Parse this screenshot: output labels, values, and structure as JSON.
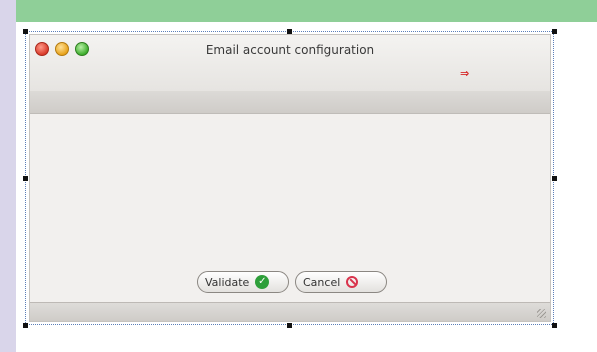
{
  "window": {
    "title": "Email account configuration"
  },
  "title_controls": {
    "close_glyph": "",
    "minimize_glyph": "",
    "maximize_glyph": ""
  },
  "icons": {
    "arrow": "arrow-right-icon",
    "validate": "check-circle-icon",
    "cancel": "no-entry-icon",
    "resize": "resize-grip-icon"
  },
  "buttons": {
    "validate_label": "Validate",
    "cancel_label": "Cancel"
  },
  "colors": {
    "top_band": "#8fcf98",
    "left_band": "#d9d5ea",
    "accent_red": "#d62a2a",
    "validate_green": "#2e9f3a",
    "cancel_red": "#d9344d"
  }
}
